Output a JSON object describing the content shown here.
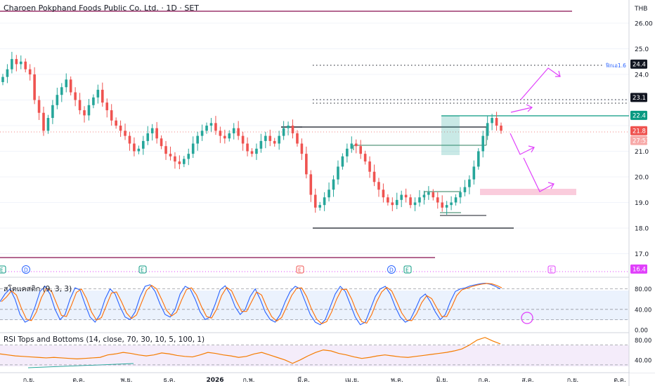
{
  "header": {
    "symbol_title": "Charoen Pokphand Foods Public Co. Ltd. · 1D · SET",
    "currency": "THB"
  },
  "price_axis": {
    "ticks": [
      "26.00",
      "25.0",
      "24.0",
      "21.0",
      "20.0",
      "19.0",
      "18.0",
      "17.0"
    ],
    "badges": [
      {
        "text": "24.4",
        "price": 24.4,
        "style": "dark"
      },
      {
        "text": "23.1",
        "price": 23.1,
        "style": "dark"
      },
      {
        "text": "22.4",
        "price": 22.4,
        "style": "green"
      },
      {
        "text": "21.8",
        "price": 21.8,
        "style": "red"
      },
      {
        "text": "27:51",
        "price": 21.42,
        "style": "redlight"
      },
      {
        "text": "16.4",
        "price": 16.4,
        "style": "magenta"
      }
    ],
    "fib_label": "ฟิกเอ1.6",
    "colors": {
      "up": "#26a69a",
      "down": "#ef5350",
      "green": "#089981",
      "magenta": "#e040fb"
    }
  },
  "events": [
    {
      "label": "E",
      "x": 3,
      "color": "#089981"
    },
    {
      "label": "D",
      "x": 37,
      "color": "#2962ff"
    },
    {
      "label": "E",
      "x": 203,
      "color": "#089981"
    },
    {
      "label": "E",
      "x": 427,
      "color": "#ef5350"
    },
    {
      "label": "D",
      "x": 557,
      "color": "#2962ff"
    },
    {
      "label": "E",
      "x": 580,
      "color": "#089981"
    },
    {
      "label": "E",
      "x": 785,
      "color": "#e040fb"
    }
  ],
  "stoch": {
    "label": "สโตแคสติก (9, 3, 3)",
    "ticks": [
      "80.00",
      "40.00",
      "0.00"
    ]
  },
  "rsi": {
    "label": "RSI Tops and Bottoms (14, close, 70, 30, 10, 5, 100, 1)",
    "ticks": [
      "80.00",
      "40.00"
    ]
  },
  "time_axis": [
    "ก.ย.",
    "ต.ค.",
    "พ.ย.",
    "ธ.ค.",
    "2026",
    "ก.พ.",
    "มี.ค.",
    "เม.ย.",
    "พ.ค.",
    "มิ.ย.",
    "ก.ค.",
    "ส.ค.",
    "ก.ย.",
    "ต.ค."
  ],
  "chart_data": {
    "type": "candlestick",
    "x_axis": "date",
    "y_axis": "price (THB)",
    "ylim": [
      16.4,
      26.2
    ],
    "grid": true,
    "series": [
      {
        "values": [
          23.9,
          24.2,
          24.6,
          24.4,
          24.5,
          24.2,
          24.0,
          23.0,
          22.5,
          21.8,
          22.3,
          22.8,
          23.2,
          23.5,
          23.8,
          23.3,
          23.0,
          22.6,
          22.4,
          22.8,
          23.1,
          23.4,
          22.9,
          22.6,
          22.2,
          22.0,
          21.8,
          21.6,
          21.3,
          21.0,
          21.1,
          21.4,
          21.7,
          21.9,
          21.5,
          21.2,
          20.9,
          20.8,
          20.6,
          20.5,
          20.7,
          20.9,
          21.3,
          21.6,
          21.8,
          22.0,
          22.1,
          21.8,
          21.6,
          21.5,
          21.7,
          21.9,
          21.6,
          21.3,
          21.0,
          20.9,
          21.1,
          21.4,
          21.6,
          21.4,
          21.3,
          21.6,
          21.9,
          22.0,
          21.7,
          21.3,
          20.9,
          20.1,
          19.3,
          18.8,
          18.9,
          19.2,
          19.5,
          19.9,
          20.4,
          20.8,
          21.1,
          21.3,
          21.2,
          20.9,
          20.6,
          20.2,
          19.8,
          19.5,
          19.2,
          19.0,
          18.9,
          19.1,
          19.3,
          19.2,
          18.9,
          19.0,
          19.2,
          19.3,
          19.4,
          19.2,
          19.0,
          18.8,
          18.9,
          19.0,
          19.2,
          19.4,
          19.6,
          19.9,
          20.4,
          21.0,
          21.6,
          22.1,
          22.3,
          22.0,
          21.8
        ]
      },
      {
        "name": "stochastic",
        "ylim": [
          0,
          100
        ],
        "values": [
          55,
          70,
          80,
          60,
          30,
          15,
          20,
          45,
          75,
          85,
          70,
          40,
          20,
          30,
          60,
          82,
          78,
          50,
          25,
          15,
          30,
          60,
          80,
          70,
          45,
          25,
          20,
          35,
          65,
          85,
          88,
          75,
          50,
          30,
          25,
          40,
          70,
          85,
          80,
          60,
          35,
          20,
          25,
          50,
          78,
          86,
          70,
          45,
          30,
          40,
          65,
          80,
          60,
          35,
          20,
          15,
          30,
          55,
          75,
          85,
          80,
          55,
          30,
          15,
          10,
          20,
          45,
          70,
          85,
          75,
          50,
          25,
          10,
          15,
          40,
          65,
          80,
          85,
          70,
          45,
          25,
          15,
          20,
          40,
          62,
          70,
          55,
          35,
          20,
          30,
          55,
          75,
          80,
          82,
          86,
          88,
          90,
          91,
          89,
          85,
          80
        ]
      },
      {
        "name": "rsi",
        "ylim": [
          20,
          90
        ],
        "values": [
          52,
          50,
          48,
          47,
          46,
          45,
          44,
          45,
          44,
          43,
          42,
          43,
          44,
          45,
          50,
          52,
          55,
          53,
          50,
          48,
          50,
          54,
          52,
          49,
          47,
          46,
          50,
          55,
          53,
          50,
          48,
          45,
          47,
          52,
          55,
          50,
          45,
          40,
          33,
          40,
          48,
          55,
          60,
          58,
          53,
          50,
          46,
          43,
          45,
          48,
          50,
          48,
          46,
          45,
          47,
          49,
          51,
          53,
          55,
          58,
          62,
          70,
          80,
          85,
          78,
          72
        ]
      }
    ],
    "levels": [
      22.4,
      23.1,
      24.4
    ]
  }
}
